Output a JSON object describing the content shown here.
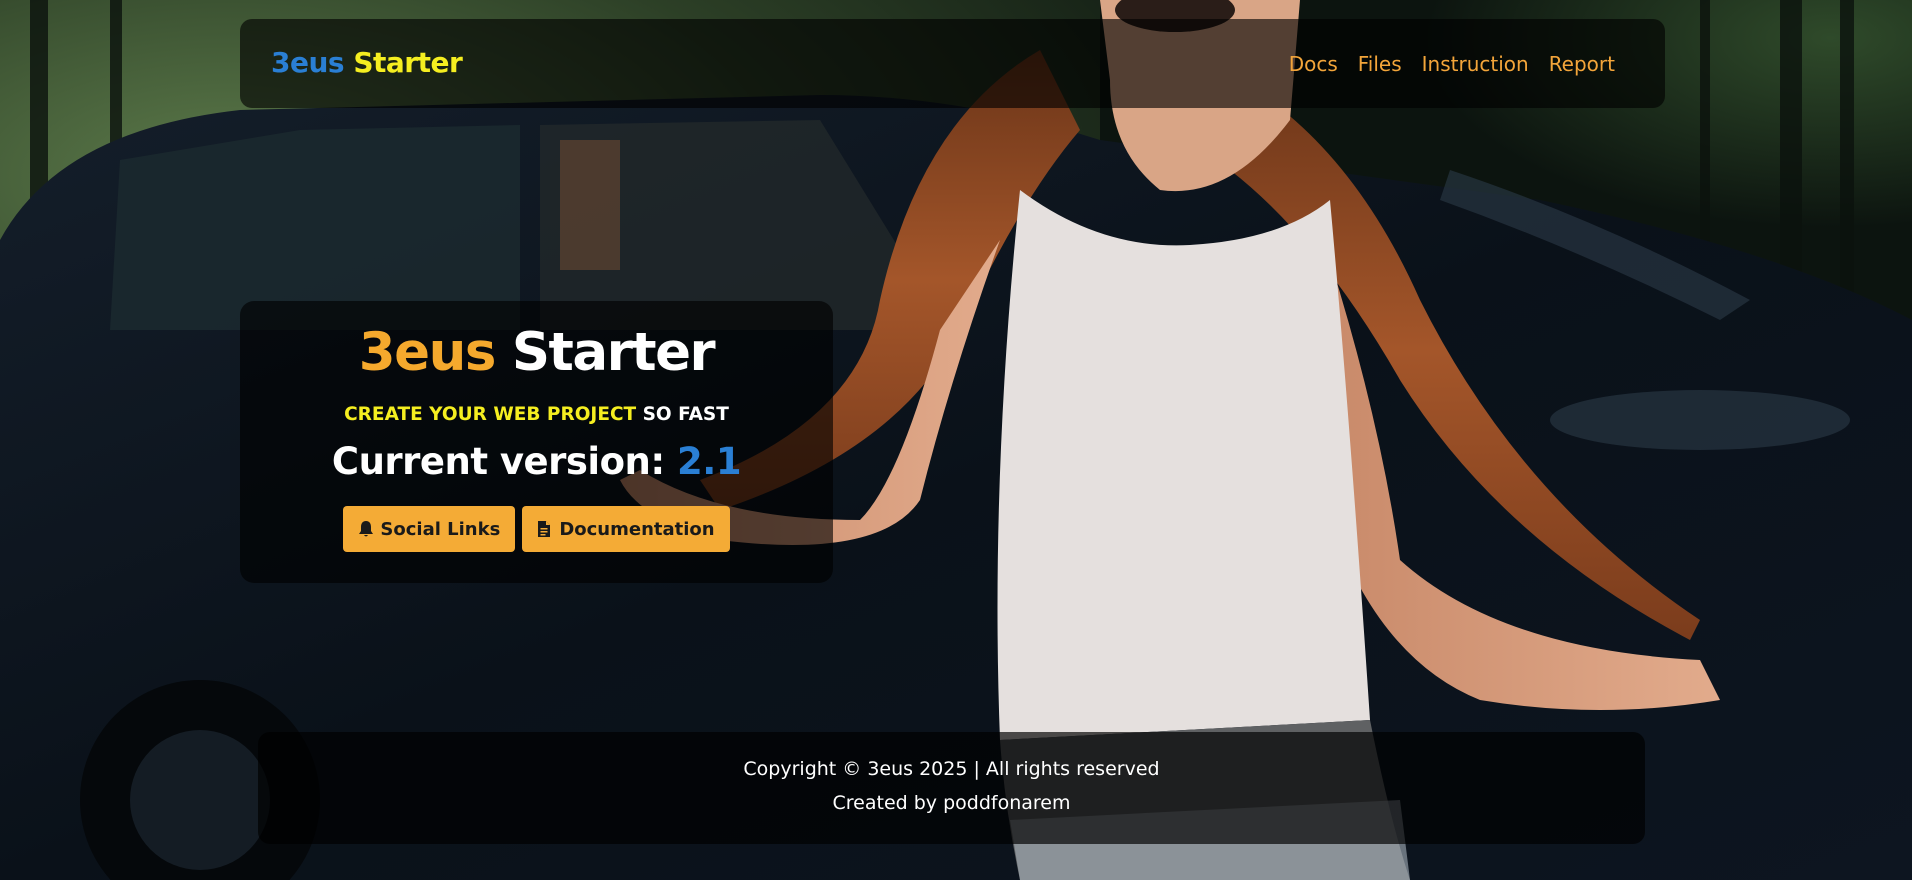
{
  "navbar": {
    "brand_part1": "3eus",
    "brand_part2": "Starter",
    "links": [
      "Docs",
      "Files",
      "Instruction",
      "Report"
    ]
  },
  "hero": {
    "title_part1": "3eus",
    "title_part2": "Starter",
    "tagline_part1": "CREATE YOUR WEB PROJECT",
    "tagline_part2": "SO FAST",
    "version_label": "Current version:",
    "version_value": "2.1",
    "buttons": [
      {
        "label": "Social Links",
        "icon": "bell-icon"
      },
      {
        "label": "Documentation",
        "icon": "file-icon"
      }
    ]
  },
  "footer": {
    "copyright": "Copyright © 3eus 2025 | All rights reserved",
    "credit": "Created by poddfonarem"
  },
  "colors": {
    "brand_blue": "#2a7fd4",
    "brand_yellow": "#f5ee20",
    "accent_orange": "#f4ab36",
    "panel_bg": "rgba(0,0,0,0.62)"
  }
}
